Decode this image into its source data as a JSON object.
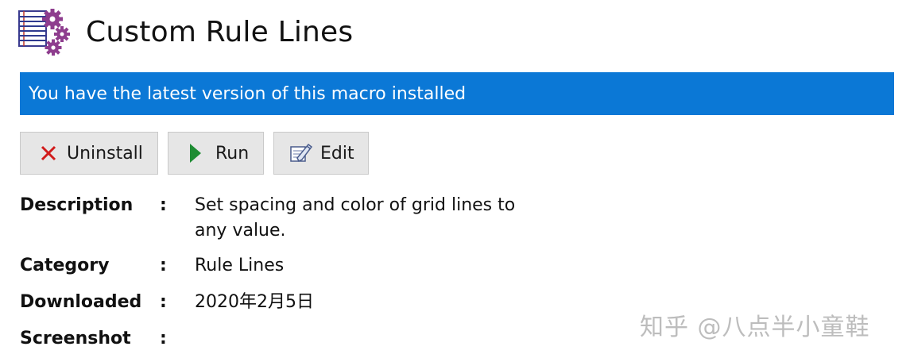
{
  "header": {
    "title": "Custom Rule Lines",
    "icon": "rule-lines-gear-icon"
  },
  "banner": {
    "text": "You have the latest version of this macro installed",
    "color": "#0b78d6"
  },
  "actions": {
    "uninstall_label": "Uninstall",
    "run_label": "Run",
    "edit_label": "Edit"
  },
  "details": {
    "description_key": "Description",
    "description_value": "Set spacing and color of grid lines to any value.",
    "category_key": "Category",
    "category_value": "Rule Lines",
    "downloaded_key": "Downloaded",
    "downloaded_value": "2020年2月5日",
    "screenshot_key": "Screenshot",
    "separator": ":"
  },
  "watermark": {
    "text": "知乎 @八点半小童鞋"
  }
}
